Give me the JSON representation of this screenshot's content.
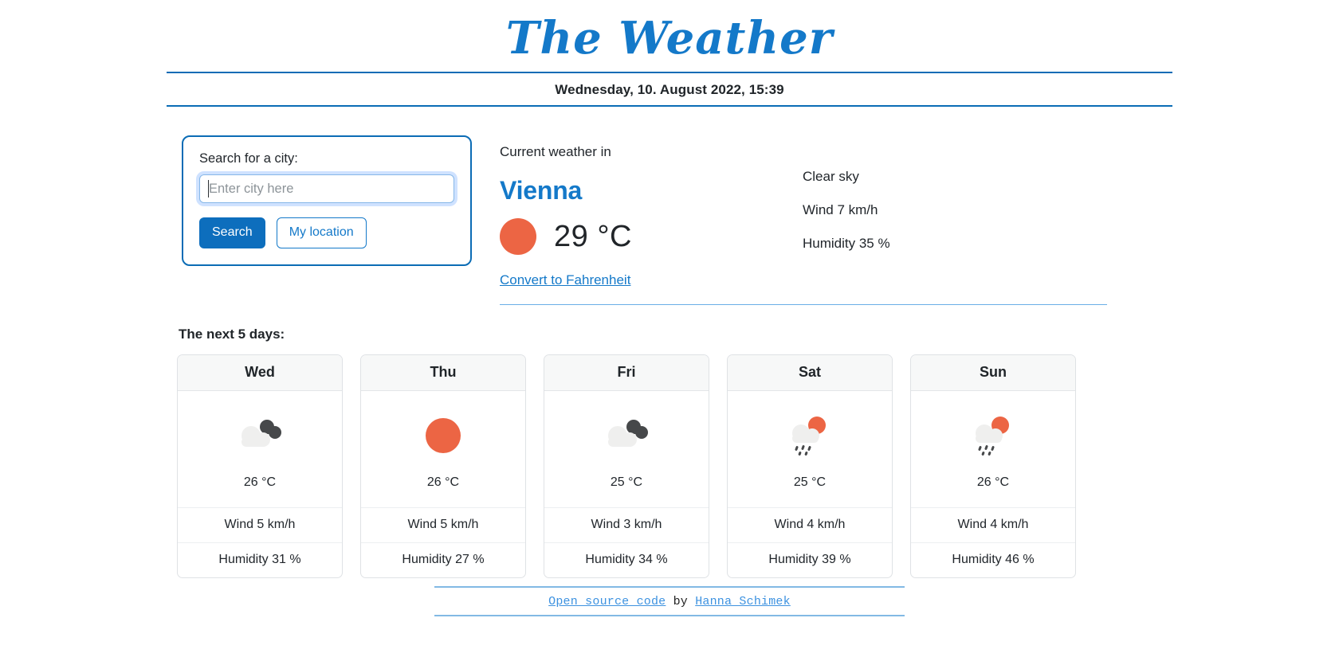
{
  "header": {
    "title": "The Weather",
    "datetime": "Wednesday, 10. August 2022, 15:39"
  },
  "search": {
    "label": "Search for a city:",
    "input_value": "",
    "placeholder": "Enter city here",
    "search_button": "Search",
    "location_button": "My location"
  },
  "current": {
    "prefix": "Current weather in",
    "city": "Vienna",
    "icon": "sun-icon",
    "temperature": "29 °C",
    "description": "Clear sky",
    "wind": "Wind 7 km/h",
    "humidity": "Humidity 35 %",
    "convert_link": "Convert to Fahrenheit"
  },
  "forecast": {
    "title": "The next 5 days:",
    "days": [
      {
        "day": "Wed",
        "icon": "overcast-clouds-icon",
        "temperature": "26 °C",
        "wind": "Wind 5 km/h",
        "humidity": "Humidity 31 %"
      },
      {
        "day": "Thu",
        "icon": "sun-icon",
        "temperature": "26 °C",
        "wind": "Wind 5 km/h",
        "humidity": "Humidity 27 %"
      },
      {
        "day": "Fri",
        "icon": "overcast-clouds-icon",
        "temperature": "25 °C",
        "wind": "Wind 3 km/h",
        "humidity": "Humidity 34 %"
      },
      {
        "day": "Sat",
        "icon": "sun-rain-cloud-icon",
        "temperature": "25 °C",
        "wind": "Wind 4 km/h",
        "humidity": "Humidity 39 %"
      },
      {
        "day": "Sun",
        "icon": "sun-rain-cloud-icon",
        "temperature": "26 °C",
        "wind": "Wind 4 km/h",
        "humidity": "Humidity 46 %"
      }
    ]
  },
  "footer": {
    "link_code": "Open source code",
    "by": " by ",
    "link_author": "Hanna Schimek"
  },
  "colors": {
    "brand_blue": "#1479c9",
    "rule_blue": "#0b6cb5",
    "button_blue": "#0d6ebd",
    "sun_orange": "#ec6544",
    "cloud_light": "#efefee",
    "cloud_dark": "#46484a",
    "footer_link": "#3d92e0"
  }
}
